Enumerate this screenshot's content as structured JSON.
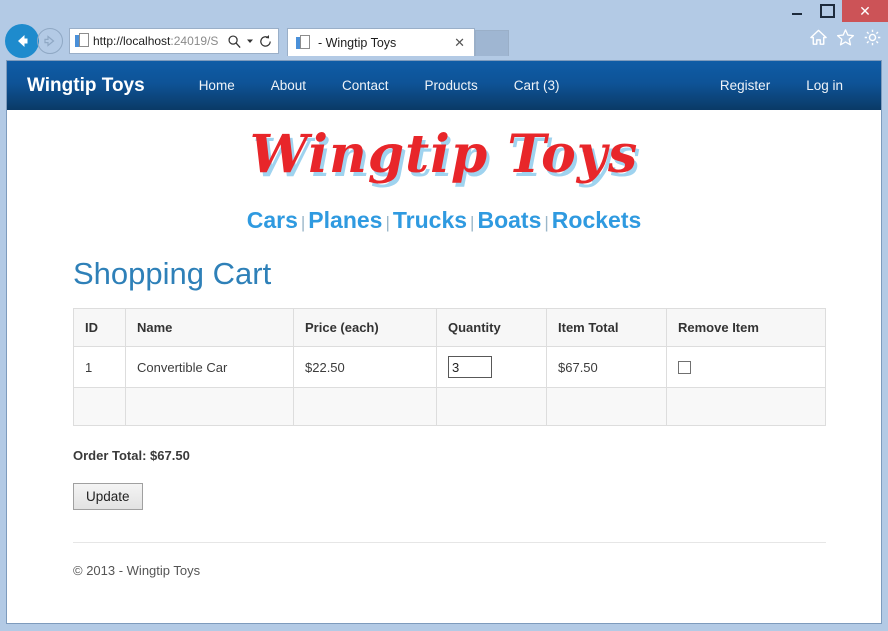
{
  "window": {
    "minimize_label": "minimize",
    "maximize_label": "maximize",
    "close_label": "✕"
  },
  "browser": {
    "back_label": "back",
    "forward_label": "forward",
    "url": "http://localhost",
    "url_dim": ":24019/S",
    "refresh_label": "refresh",
    "search_label": "search",
    "tab_title": "- Wingtip Toys",
    "tab_close_label": "✕",
    "new_tab_label": "new tab",
    "home_label": "home",
    "favorites_label": "favorites",
    "settings_label": "settings"
  },
  "navbar": {
    "brand": "Wingtip Toys",
    "links": [
      {
        "label": "Home"
      },
      {
        "label": "About"
      },
      {
        "label": "Contact"
      },
      {
        "label": "Products"
      },
      {
        "label": "Cart (3)"
      }
    ],
    "right_links": [
      {
        "label": "Register"
      },
      {
        "label": "Log in"
      }
    ]
  },
  "site": {
    "logo_text": "Wingtip Toys",
    "categories": [
      {
        "label": "Cars"
      },
      {
        "label": "Planes"
      },
      {
        "label": "Trucks"
      },
      {
        "label": "Boats"
      },
      {
        "label": "Rockets"
      }
    ],
    "separator": "|"
  },
  "cart": {
    "title": "Shopping Cart",
    "columns": [
      "ID",
      "Name",
      "Price (each)",
      "Quantity",
      "Item Total",
      "Remove Item"
    ],
    "rows": [
      {
        "id": "1",
        "name": "Convertible Car",
        "price": "$22.50",
        "quantity": "3",
        "item_total": "$67.50",
        "remove_checked": false
      }
    ],
    "order_total": "Order Total: $67.50",
    "update_label": "Update"
  },
  "footer": {
    "copyright": "© 2013 - Wingtip Toys"
  },
  "colors": {
    "navbar_top": "#0f5ca6",
    "navbar_bottom": "#0a3a66",
    "logo_red": "#e8262a",
    "logo_shadow": "#9fd3ef",
    "category_blue": "#2f9ae0",
    "heading_blue": "#2e80b8",
    "close_button_red": "#cc5357",
    "back_button_blue": "#1e8bcd"
  }
}
